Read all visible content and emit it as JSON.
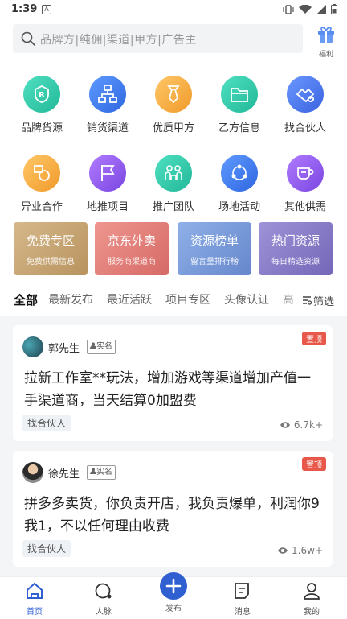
{
  "status": {
    "time": "1:39"
  },
  "search": {
    "placeholder": "品牌方|纯佣|渠道|甲方|广告主"
  },
  "gift": {
    "label": "福利"
  },
  "grid": [
    {
      "label": "品牌货源",
      "icon": "brand-r-icon",
      "color": "#2cc7a8"
    },
    {
      "label": "销货渠道",
      "icon": "channel-tree-icon",
      "color": "#3f7df0"
    },
    {
      "label": "优质甲方",
      "icon": "tie-icon",
      "color": "#f4a53a"
    },
    {
      "label": "乙方信息",
      "icon": "folder-icon",
      "color": "#2cc7a8"
    },
    {
      "label": "找合伙人",
      "icon": "handshake-icon",
      "color": "#4e7df2"
    },
    {
      "label": "异业合作",
      "icon": "cooperate-icon",
      "color": "#f4a53a"
    },
    {
      "label": "地推项目",
      "icon": "flag-icon",
      "color": "#8f5ee8"
    },
    {
      "label": "推广团队",
      "icon": "team-icon",
      "color": "#2cc7a8"
    },
    {
      "label": "场地活动",
      "icon": "share-nodes-icon",
      "color": "#3f7df0"
    },
    {
      "label": "其他供需",
      "icon": "cup-icon",
      "color": "#8f5ee8"
    }
  ],
  "banners": [
    {
      "title": "免费专区",
      "sub": "免费供需信息",
      "color": "#c9a97c"
    },
    {
      "title": "京东外卖",
      "sub": "服务商渠道商",
      "color": "#e07f7a"
    },
    {
      "title": "资源榜单",
      "sub": "留言量排行榜",
      "color": "#7e9ed8"
    },
    {
      "title": "热门资源",
      "sub": "每日精选资源",
      "color": "#8e82c8"
    }
  ],
  "tabs": [
    "全部",
    "最新发布",
    "最近活跃",
    "项目专区",
    "头像认证",
    "高"
  ],
  "filter_label": "筛选",
  "posts": [
    {
      "user": "郭先生",
      "badge": "实名",
      "pin": "置顶",
      "text": "拉新工作室**玩法，增加游戏等渠道增加产值一手渠道商，当天结算0加盟费",
      "tag": "找合伙人",
      "views": "6.7k+"
    },
    {
      "user": "徐先生",
      "badge": "实名",
      "pin": "置顶",
      "text": "拼多多卖货，你负责开店，我负责爆单，利润你9我1，不以任何理由收费",
      "tag": "找合伙人",
      "views": "1.6w+"
    }
  ],
  "nav": [
    {
      "label": "首页",
      "icon": "home-icon"
    },
    {
      "label": "人脉",
      "icon": "network-icon"
    },
    {
      "label": "发布",
      "icon": "plus-icon"
    },
    {
      "label": "消息",
      "icon": "message-icon"
    },
    {
      "label": "我的",
      "icon": "profile-icon"
    }
  ],
  "accent": "#2f5fd0"
}
